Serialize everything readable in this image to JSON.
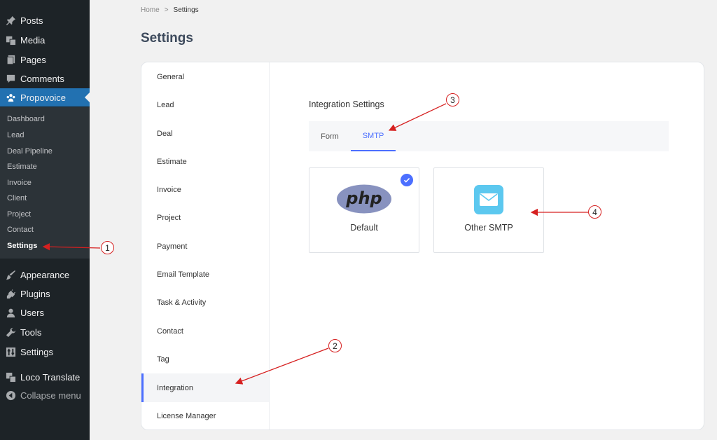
{
  "sidebar": {
    "top_items": [
      {
        "label": "Posts",
        "icon": "pin-icon"
      },
      {
        "label": "Media",
        "icon": "media-icon"
      },
      {
        "label": "Pages",
        "icon": "pages-icon"
      },
      {
        "label": "Comments",
        "icon": "comment-icon"
      },
      {
        "label": "Propovoice",
        "icon": "propovoice-icon"
      }
    ],
    "submenu": [
      "Dashboard",
      "Lead",
      "Deal Pipeline",
      "Estimate",
      "Invoice",
      "Client",
      "Project",
      "Contact",
      "Settings"
    ],
    "bottom_items": [
      {
        "label": "Appearance",
        "icon": "brush-icon"
      },
      {
        "label": "Plugins",
        "icon": "plugin-icon"
      },
      {
        "label": "Users",
        "icon": "user-icon"
      },
      {
        "label": "Tools",
        "icon": "wrench-icon"
      },
      {
        "label": "Settings",
        "icon": "settings-icon"
      },
      {
        "label": "Loco Translate",
        "icon": "translate-icon"
      },
      {
        "label": "Collapse menu",
        "icon": "collapse-icon"
      }
    ],
    "active_color": "#2271b1"
  },
  "breadcrumb": {
    "home": "Home",
    "separator": ">",
    "current": "Settings"
  },
  "page_title": "Settings",
  "settings_nav": [
    "General",
    "Lead",
    "Deal",
    "Estimate",
    "Invoice",
    "Project",
    "Payment",
    "Email Template",
    "Task & Activity",
    "Contact",
    "Tag",
    "Integration",
    "License Manager"
  ],
  "integration": {
    "title": "Integration Settings",
    "tabs": [
      "Form",
      "SMTP"
    ],
    "active_tab": "SMTP",
    "options": [
      {
        "label": "Default",
        "logo_text": "php",
        "selected": true
      },
      {
        "label": "Other SMTP",
        "icon": "mail-icon",
        "selected": false
      }
    ]
  },
  "annotations": [
    "1",
    "2",
    "3",
    "4"
  ],
  "colors": {
    "accent": "#4c6fff",
    "annotation": "#d62020"
  }
}
